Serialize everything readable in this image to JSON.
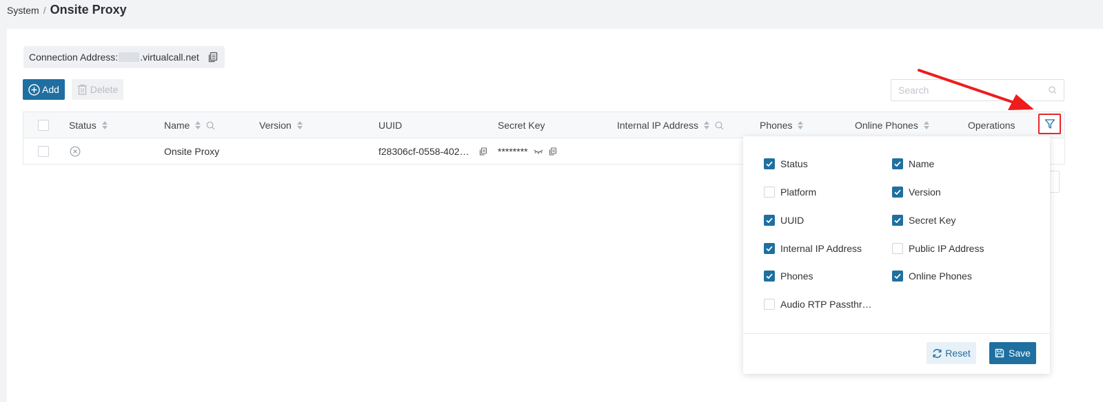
{
  "breadcrumb": {
    "parent": "System",
    "separator": "/",
    "current": "Onsite Proxy"
  },
  "connection": {
    "label": "Connection Address:",
    "value_suffix": ".virtualcall.net"
  },
  "toolbar": {
    "add_label": "Add",
    "delete_label": "Delete"
  },
  "search": {
    "placeholder": "Search"
  },
  "table": {
    "headers": {
      "status": "Status",
      "name": "Name",
      "version": "Version",
      "uuid": "UUID",
      "secret_key": "Secret Key",
      "internal_ip": "Internal IP Address",
      "phones": "Phones",
      "online_phones": "Online Phones",
      "operations": "Operations"
    },
    "rows": [
      {
        "status": "offline",
        "name": "Onsite Proxy",
        "version": "",
        "uuid": "f28306cf-0558-402…",
        "secret_key": "********"
      }
    ]
  },
  "column_filter": {
    "options": [
      {
        "label": "Status",
        "checked": true
      },
      {
        "label": "Name",
        "checked": true
      },
      {
        "label": "Platform",
        "checked": false
      },
      {
        "label": "Version",
        "checked": true
      },
      {
        "label": "UUID",
        "checked": true
      },
      {
        "label": "Secret Key",
        "checked": true
      },
      {
        "label": "Internal IP Address",
        "checked": true
      },
      {
        "label": "Public IP Address",
        "checked": false
      },
      {
        "label": "Phones",
        "checked": true
      },
      {
        "label": "Online Phones",
        "checked": true
      },
      {
        "label": "Audio RTP Passthr…",
        "checked": false
      }
    ],
    "reset_label": "Reset",
    "save_label": "Save"
  },
  "colors": {
    "primary": "#1f6fa1",
    "highlight": "#e8262a"
  },
  "icons": [
    "copy-icon",
    "plus-circle-icon",
    "trash-icon",
    "search-icon",
    "sort-icon",
    "filter-icon",
    "close-circle-icon",
    "eye-closed-icon",
    "refresh-icon",
    "save-icon",
    "check-icon"
  ]
}
